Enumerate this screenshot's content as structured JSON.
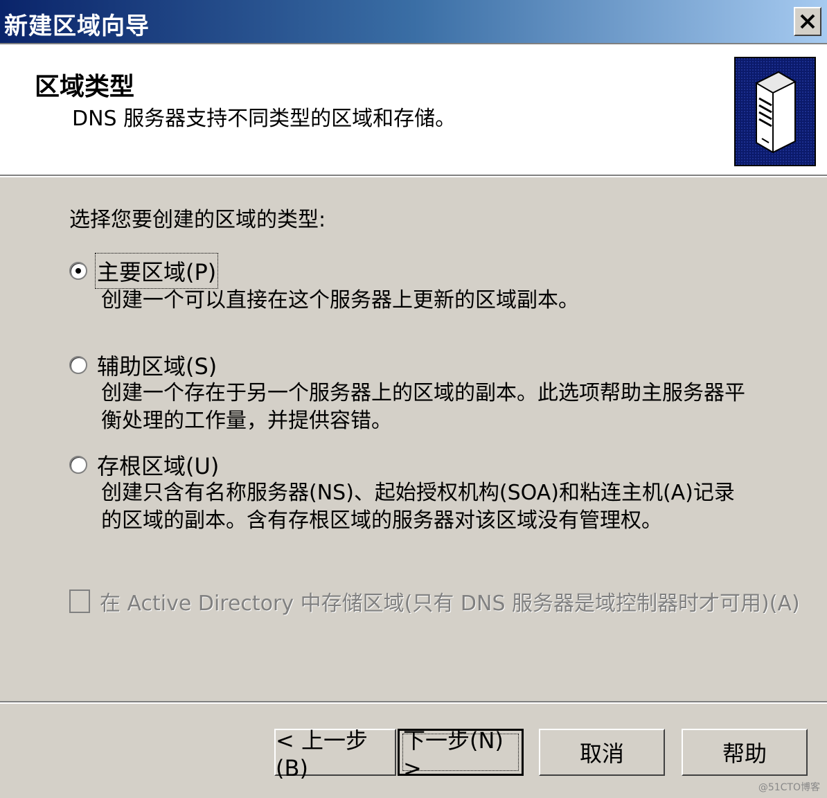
{
  "window": {
    "title": "新建区域向导",
    "close_label": "X"
  },
  "header": {
    "title": "区域类型",
    "subtitle": "DNS 服务器支持不同类型的区域和存储。",
    "icon": "server-icon"
  },
  "prompt": "选择您要创建的区域的类型:",
  "options": [
    {
      "label": "主要区域(P)",
      "description": "创建一个可以直接在这个服务器上更新的区域副本。",
      "selected": true
    },
    {
      "label": "辅助区域(S)",
      "description": "创建一个存在于另一个服务器上的区域的副本。此选项帮助主服务器平衡处理的工作量，并提供容错。",
      "selected": false
    },
    {
      "label": "存根区域(U)",
      "description": "创建只含有名称服务器(NS)、起始授权机构(SOA)和粘连主机(A)记录的区域的副本。含有存根区域的服务器对该区域没有管理权。",
      "selected": false
    }
  ],
  "checkbox": {
    "label": "在 Active Directory 中存储区域(只有 DNS 服务器是域控制器时才可用)(A)",
    "checked": false,
    "disabled": true
  },
  "buttons": {
    "back": "< 上一步(B)",
    "next": "下一步(N) >",
    "cancel": "取消",
    "help": "帮助"
  },
  "watermark": "@51CTO博客"
}
